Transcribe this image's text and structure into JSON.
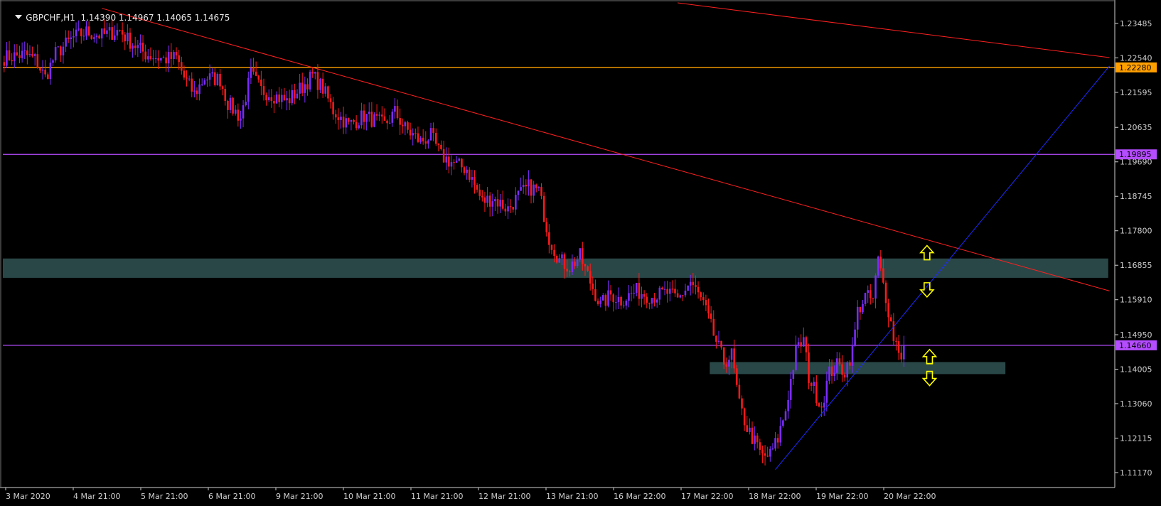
{
  "header": {
    "symbol": "GBPCHF,H1",
    "ohlc": "1.14390 1.14967 1.14065 1.14675"
  },
  "colors": {
    "background": "#000000",
    "bull": "#7b2cff",
    "bear": "#ff1a1a",
    "axis": "#cfcfcf",
    "zone": "#2f4f4f",
    "trend_red": "#ff2020",
    "trend_blue": "#1f2aff",
    "level_orange": "#ffa000",
    "level_purple": "#b44cff",
    "arrow": "#ffff00"
  },
  "chart_data": {
    "type": "candlestick",
    "ylim": [
      1.1076,
      1.2405
    ],
    "y_ticks": [
      "1.23485",
      "1.22540",
      "1.21595",
      "1.20635",
      "1.19690",
      "1.18745",
      "1.17800",
      "1.16855",
      "1.15910",
      "1.14950",
      "1.14005",
      "1.13060",
      "1.12115",
      "1.11170"
    ],
    "x_ticks": [
      "3 Mar 2020",
      "4 Mar 21:00",
      "5 Mar 21:00",
      "6 Mar 21:00",
      "9 Mar 21:00",
      "10 Mar 21:00",
      "11 Mar 21:00",
      "12 Mar 21:00",
      "13 Mar 21:00",
      "16 Mar 22:00",
      "17 Mar 22:00",
      "18 Mar 22:00",
      "19 Mar 22:00",
      "20 Mar 22:00"
    ],
    "levels": [
      {
        "price": 1.2228,
        "label": "1.22280",
        "color": "orange"
      },
      {
        "price": 1.19895,
        "label": "1.19895",
        "color": "purple"
      },
      {
        "price": 1.1466,
        "label": "1.14660",
        "color": "purple"
      }
    ],
    "zones": [
      {
        "from_bar": 0,
        "to_bar": 430,
        "top": 1.1704,
        "bottom": 1.1651
      },
      {
        "from_bar": 275,
        "to_bar": 390,
        "top": 1.142,
        "bottom": 1.1387
      }
    ],
    "trendlines": [
      {
        "color": "red",
        "p1": [
          38,
          1.239
        ],
        "p2": [
          430,
          1.1615
        ]
      },
      {
        "color": "red",
        "p1": [
          262,
          1.2405
        ],
        "p2": [
          430,
          1.2255
        ]
      },
      {
        "color": "blue",
        "p1": [
          300,
          1.1125
        ],
        "p2": [
          430,
          1.2232
        ]
      }
    ],
    "arrows": [
      {
        "dir": "up",
        "bar": 359,
        "price": 1.172
      },
      {
        "dir": "down",
        "bar": 359,
        "price": 1.1618
      },
      {
        "dir": "up",
        "bar": 360,
        "price": 1.1435
      },
      {
        "dir": "down",
        "bar": 360,
        "price": 1.1375
      }
    ],
    "path": [
      [
        0,
        1.2255
      ],
      [
        8,
        1.2263
      ],
      [
        12,
        1.225
      ],
      [
        16,
        1.22
      ],
      [
        20,
        1.2265
      ],
      [
        27,
        1.231
      ],
      [
        32,
        1.2325
      ],
      [
        38,
        1.2315
      ],
      [
        45,
        1.233
      ],
      [
        48,
        1.2305
      ],
      [
        55,
        1.2265
      ],
      [
        62,
        1.225
      ],
      [
        67,
        1.2255
      ],
      [
        70,
        1.22
      ],
      [
        74,
        1.2155
      ],
      [
        78,
        1.22
      ],
      [
        84,
        1.2195
      ],
      [
        87,
        1.213
      ],
      [
        92,
        1.209
      ],
      [
        96,
        1.221
      ],
      [
        100,
        1.2165
      ],
      [
        104,
        1.2155
      ],
      [
        110,
        1.2135
      ],
      [
        116,
        1.2175
      ],
      [
        120,
        1.2205
      ],
      [
        124,
        1.217
      ],
      [
        128,
        1.211
      ],
      [
        134,
        1.207
      ],
      [
        140,
        1.2095
      ],
      [
        148,
        1.207
      ],
      [
        152,
        1.2105
      ],
      [
        156,
        1.206
      ],
      [
        162,
        1.2025
      ],
      [
        166,
        1.204
      ],
      [
        170,
        1.1985
      ],
      [
        176,
        1.196
      ],
      [
        180,
        1.195
      ],
      [
        186,
        1.186
      ],
      [
        190,
        1.187
      ],
      [
        196,
        1.184
      ],
      [
        200,
        1.1875
      ],
      [
        204,
        1.19
      ],
      [
        208,
        1.189
      ],
      [
        212,
        1.176
      ],
      [
        216,
        1.17
      ],
      [
        220,
        1.168
      ],
      [
        224,
        1.171
      ],
      [
        228,
        1.164
      ],
      [
        232,
        1.1575
      ],
      [
        236,
        1.1605
      ],
      [
        240,
        1.159
      ],
      [
        246,
        1.1615
      ],
      [
        252,
        1.16
      ],
      [
        258,
        1.161
      ],
      [
        262,
        1.159
      ],
      [
        267,
        1.164
      ],
      [
        272,
        1.158
      ],
      [
        276,
        1.1495
      ],
      [
        280,
        1.142
      ],
      [
        283,
        1.144
      ],
      [
        286,
        1.13
      ],
      [
        289,
        1.124
      ],
      [
        292,
        1.12
      ],
      [
        295,
        1.116
      ],
      [
        298,
        1.1165
      ],
      [
        301,
        1.121
      ],
      [
        304,
        1.129
      ],
      [
        308,
        1.145
      ],
      [
        311,
        1.148
      ],
      [
        313,
        1.138
      ],
      [
        316,
        1.133
      ],
      [
        318,
        1.13
      ],
      [
        321,
        1.139
      ],
      [
        324,
        1.141
      ],
      [
        327,
        1.1395
      ],
      [
        330,
        1.145
      ],
      [
        332,
        1.156
      ],
      [
        335,
        1.16
      ],
      [
        338,
        1.159
      ],
      [
        340,
        1.17
      ],
      [
        343,
        1.16
      ],
      [
        346,
        1.149
      ],
      [
        349,
        1.144
      ],
      [
        350,
        1.1467
      ]
    ]
  }
}
